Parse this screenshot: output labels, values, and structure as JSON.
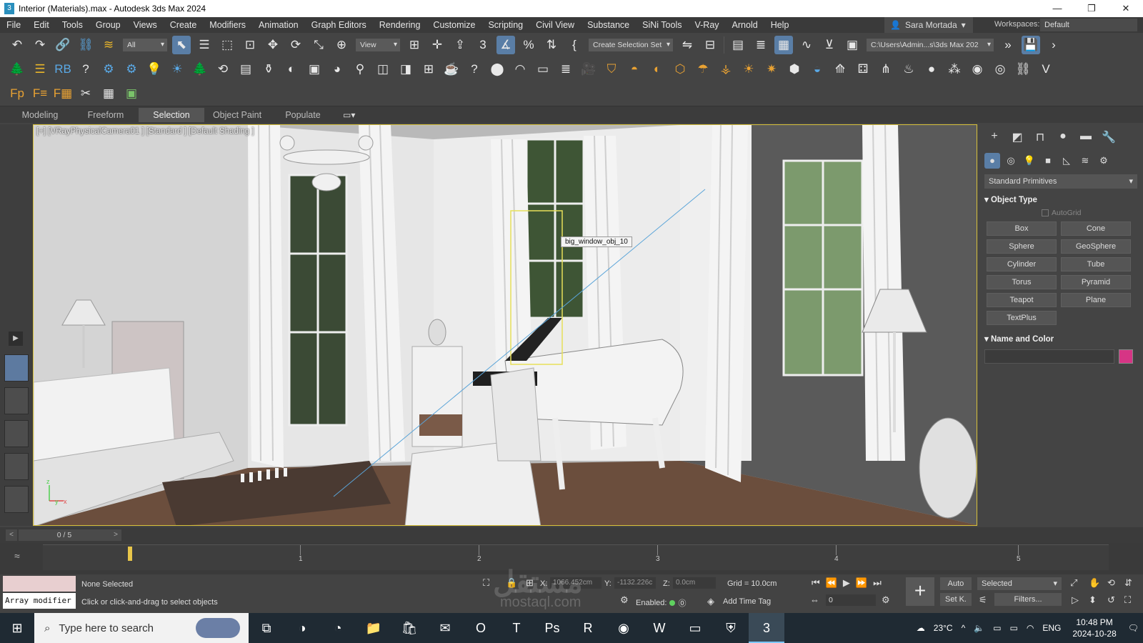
{
  "window": {
    "title": "Interior (Materials).max - Autodesk 3ds Max 2024",
    "minimize": "—",
    "maximize": "❐",
    "close": "✕"
  },
  "menu": [
    "File",
    "Edit",
    "Tools",
    "Group",
    "Views",
    "Create",
    "Modifiers",
    "Animation",
    "Graph Editors",
    "Rendering",
    "Customize",
    "Scripting",
    "Civil View",
    "Substance",
    "SiNi Tools",
    "V-Ray",
    "Arnold",
    "Help"
  ],
  "user": {
    "name": "Sara Mortada"
  },
  "workspace": {
    "label": "Workspaces:",
    "value": "Default"
  },
  "toolbar": {
    "filter_value": "All",
    "refcoord_value": "View",
    "selection_set_value": "Create Selection Set",
    "project_path": "C:\\Users\\Admin...s\\3ds Max 202"
  },
  "ribbon": {
    "tabs": [
      "Modeling",
      "Freeform",
      "Selection",
      "Object Paint",
      "Populate"
    ],
    "active": "Selection"
  },
  "viewport": {
    "label": "[+] [VRayPhysicalCamera01 ] [Standard ] [Default Shading ]",
    "tooltip": "big_window_obj_10"
  },
  "command_panel": {
    "category": "Standard Primitives",
    "object_type_title": "Object Type",
    "autogrid": "AutoGrid",
    "buttons": [
      "Box",
      "Cone",
      "Sphere",
      "GeoSphere",
      "Cylinder",
      "Tube",
      "Torus",
      "Pyramid",
      "Teapot",
      "Plane",
      "TextPlus"
    ],
    "name_color_title": "Name and Color",
    "color": "#d63585"
  },
  "timeline": {
    "frame_display": "0 / 5",
    "ticks": [
      "1",
      "2",
      "3",
      "4",
      "5"
    ]
  },
  "status": {
    "maxscript_text": "Array modifier",
    "selection": "None Selected",
    "prompt": "Click or click-and-drag to select objects",
    "x_label": "X:",
    "x_value": "1066.452cm",
    "y_label": "Y:",
    "y_value": "-1132.226c",
    "z_label": "Z:",
    "z_value": "0.0cm",
    "grid": "Grid = 10.0cm",
    "enabled": "Enabled:",
    "add_time_tag": "Add Time Tag",
    "frame": "0",
    "auto": "Auto",
    "set_key": "Set K.",
    "selected_dd": "Selected",
    "filters": "Filters..."
  },
  "taskbar": {
    "search_placeholder": "Type here to search",
    "weather": "23°C",
    "lang": "ENG",
    "time": "10:48 PM",
    "date": "2024-10-28"
  },
  "watermark": {
    "arabic": "مستقل",
    "latin": "mostaql.com"
  }
}
